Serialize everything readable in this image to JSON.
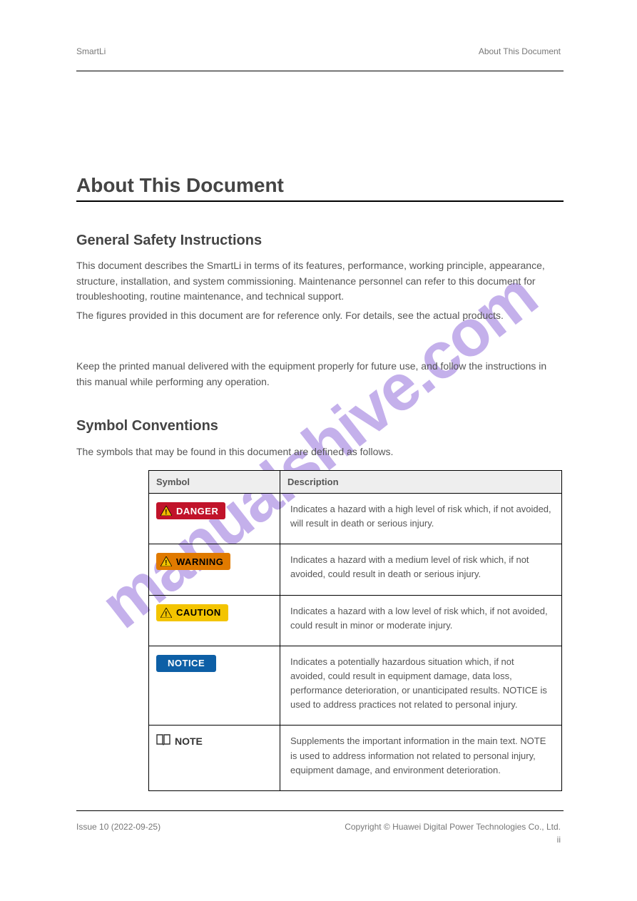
{
  "header": {
    "left": "SmartLi",
    "right": "About This Document"
  },
  "chapter": "About This Document",
  "sections": {
    "general": {
      "title": "General Safety Instructions",
      "para1": "This document describes the SmartLi in terms of its features, performance, working principle, appearance, structure, installation, and system commissioning. Maintenance personnel can refer to this document for troubleshooting, routine maintenance, and technical support.",
      "para2": "The figures provided in this document are for reference only. For details, see the actual products.",
      "para3": "Keep the printed manual delivered with the equipment properly for future use, and follow the instructions in this manual while performing any operation."
    },
    "symbols": {
      "title": "Symbol Conventions",
      "intro": "The symbols that may be found in this document are defined as follows."
    }
  },
  "table": {
    "head": {
      "symbol": "Symbol",
      "description": "Description"
    },
    "rows": [
      {
        "label": "DANGER",
        "klass": "danger",
        "has_triangle": true,
        "tri_fill": "#f3b900",
        "tri_stroke": "#000",
        "desc": "Indicates a hazard with a high level of risk which, if not avoided, will result in death or serious injury."
      },
      {
        "label": "WARNING",
        "klass": "warning",
        "has_triangle": true,
        "tri_fill": "#f3c400",
        "tri_stroke": "#000",
        "desc": "Indicates a hazard with a medium level of risk which, if not avoided, could result in death or serious injury."
      },
      {
        "label": "CAUTION",
        "klass": "caution",
        "has_triangle": true,
        "tri_fill": "#f3c400",
        "tri_stroke": "#000",
        "desc": "Indicates a hazard with a low level of risk which, if not avoided, could result in minor or moderate injury."
      },
      {
        "label": "NOTICE",
        "klass": "notice",
        "has_triangle": false,
        "desc": "Indicates a potentially hazardous situation which, if not avoided, could result in equipment damage, data loss, performance deterioration, or unanticipated results.\nNOTICE is used to address practices not related to personal injury."
      },
      {
        "label": "NOTE",
        "klass": "note",
        "has_triangle": false,
        "desc": "Supplements the important information in the main text.\nNOTE is used to address information not related to personal injury, equipment damage, and environment deterioration."
      }
    ]
  },
  "footer": {
    "issue": "Issue 10 (2022-09-25)",
    "copyright": "Copyright © Huawei Digital Power Technologies Co., Ltd.",
    "page": "ii"
  },
  "watermark": "manualshive.com"
}
